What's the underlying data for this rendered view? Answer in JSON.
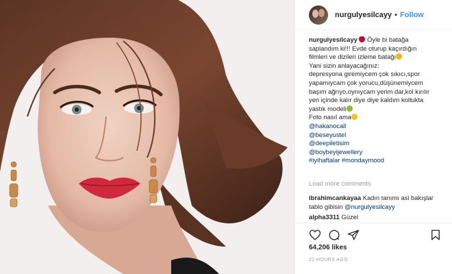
{
  "header": {
    "username": "nurgulyesilcayy",
    "separator": "•",
    "follow_label": "Follow"
  },
  "caption": {
    "username": "nurgulyesilcayy",
    "lines": [
      "Öyle bi batağa",
      "saplandım ki!!! Evde oturup kaçırdığın",
      "filmleri ve dizileri izleme batağı",
      "Yani sizin anlayacağınız:",
      "depresyona giremiycem çok sıkıcı,spor",
      "yapamıycam çok yorucu,düşünemiycem",
      "başım ağrıyo,oynıycam yerim dar,kol kırılır",
      "yen içinde kalır diye diye kaldım koltukta",
      "yastık modeli",
      "Foto nasıl ama"
    ],
    "mentions": [
      "@hakanocall",
      "@beseyustel",
      "@deepiletisim",
      "@boybeyijewellery"
    ],
    "hashtags": "#iyihaftalar #mondaymood"
  },
  "load_more": "Load more comments",
  "comments": [
    {
      "user": "ibrahimcankayaa",
      "text": "Kadın tanımı asi bakışlar",
      "text2": "tablo gibisin",
      "mention": "@nurgulyesilcayy"
    },
    {
      "user": "alpha3311",
      "text": "Güzel"
    }
  ],
  "likes": "64,206 likes",
  "time_ago": "22 HOURS AGO",
  "icons": [
    "heart-icon",
    "comment-icon",
    "share-icon",
    "bookmark-icon"
  ],
  "colors": {
    "link": "#3897f0",
    "mention": "#003569",
    "muted": "#999999",
    "text": "#262626"
  }
}
